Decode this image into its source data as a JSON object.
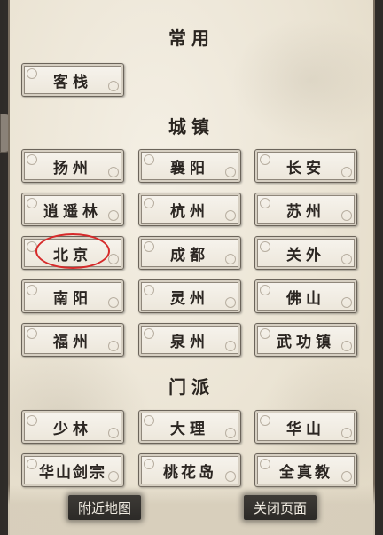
{
  "sections": {
    "common": {
      "title": "常用",
      "items": [
        "客栈"
      ]
    },
    "towns": {
      "title": "城镇",
      "items": [
        "扬州",
        "襄阳",
        "长安",
        "逍遥林",
        "杭州",
        "苏州",
        "北京",
        "成都",
        "关外",
        "南阳",
        "灵州",
        "佛山",
        "福州",
        "泉州",
        "武功镇"
      ]
    },
    "sects": {
      "title": "门派",
      "items": [
        "少林",
        "大理",
        "华山",
        "华山剑宗",
        "桃花岛",
        "全真教"
      ]
    }
  },
  "footer": {
    "nearby_map_label": "附近地图",
    "close_page_label": "关闭页面"
  },
  "highlighted_item": "北京",
  "colors": {
    "panel_bg": "#ebe4d4",
    "button_text": "#2b2622",
    "highlight_ring": "#d62a2a",
    "footer_button_bg": "#2c2a27"
  }
}
